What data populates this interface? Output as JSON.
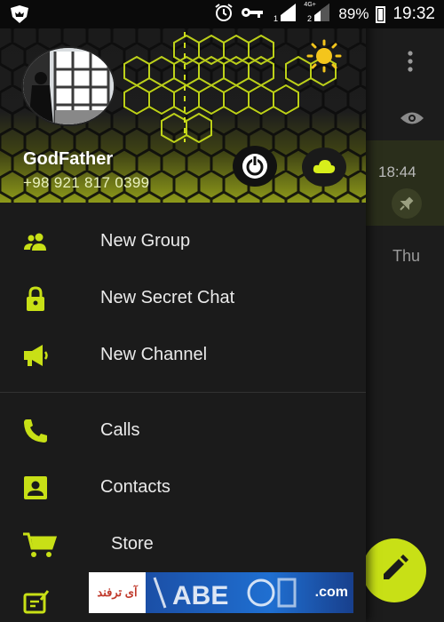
{
  "status_bar": {
    "battery": "89%",
    "time": "19:32",
    "network_label": "4G+",
    "icons": [
      "app-shield-icon",
      "alarm-icon",
      "key-icon",
      "signal-sim1-icon",
      "signal-sim2-icon",
      "battery-icon"
    ]
  },
  "background": {
    "time": "18:44",
    "day": "Thu",
    "icons": [
      "more-vert-icon",
      "eye-icon",
      "pin-icon",
      "pencil-icon"
    ]
  },
  "header": {
    "name": "GodFather",
    "phone": "+98 921 817 0399",
    "icons": [
      "sun-icon",
      "power-icon",
      "cloud-icon"
    ]
  },
  "menu": {
    "items": [
      {
        "label": "New Group",
        "icon": "group-icon"
      },
      {
        "label": "New Secret Chat",
        "icon": "lock-icon"
      },
      {
        "label": "New Channel",
        "icon": "megaphone-icon"
      },
      {
        "label": "Calls",
        "icon": "phone-icon"
      },
      {
        "label": "Contacts",
        "icon": "contact-icon"
      },
      {
        "label": "Store",
        "icon": "cart-icon"
      }
    ]
  },
  "watermark": {
    "text_persian": "آی ترفند",
    "text_com": ".com"
  },
  "colors": {
    "accent": "#c8e016",
    "drawer_bg": "#1b1b1b",
    "text": "#eaeaea"
  }
}
